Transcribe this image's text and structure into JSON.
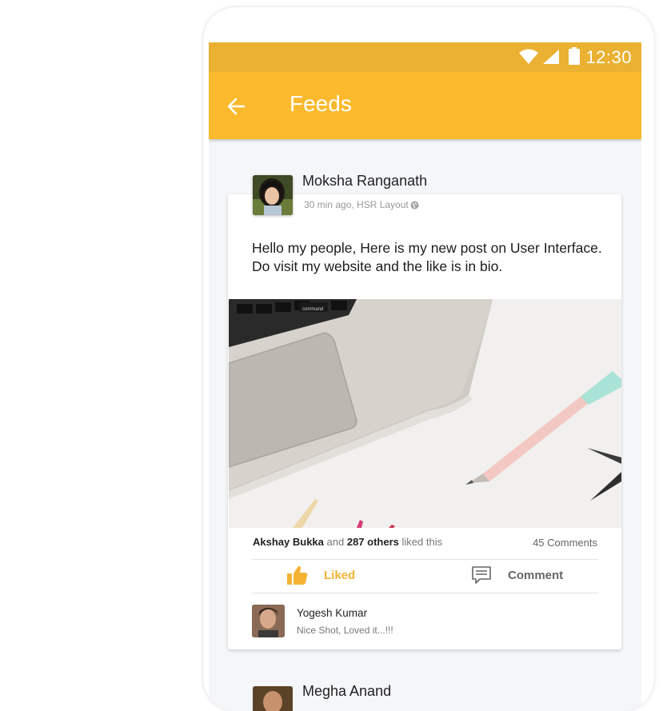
{
  "status_bar": {
    "time": "12:30"
  },
  "app_bar": {
    "title": "Feeds",
    "back_icon": "arrow-left-icon"
  },
  "post": {
    "author": "Moksha Ranganath",
    "meta": "30 min ago, HSR Layout",
    "text_line1": "Hello my people, Here is my new post on User Interface.",
    "text_line2": "Do visit my website and the like is in bio.",
    "likes": {
      "user": "Akshay Bukka",
      "and": "and",
      "others": "287 others",
      "suffix": "liked this"
    },
    "comments_count": "45 Comments",
    "actions": {
      "like_label": "Liked",
      "comment_label": "Comment"
    },
    "comment": {
      "author": "Yogesh Kumar",
      "text": "Nice Shot, Loved it...!!!"
    },
    "image_keycap_label": "command"
  },
  "next_post": {
    "author": "Megha Anand"
  },
  "colors": {
    "accent": "#fbba2d",
    "status_bar": "#eab132",
    "liked": "#f5b335"
  }
}
